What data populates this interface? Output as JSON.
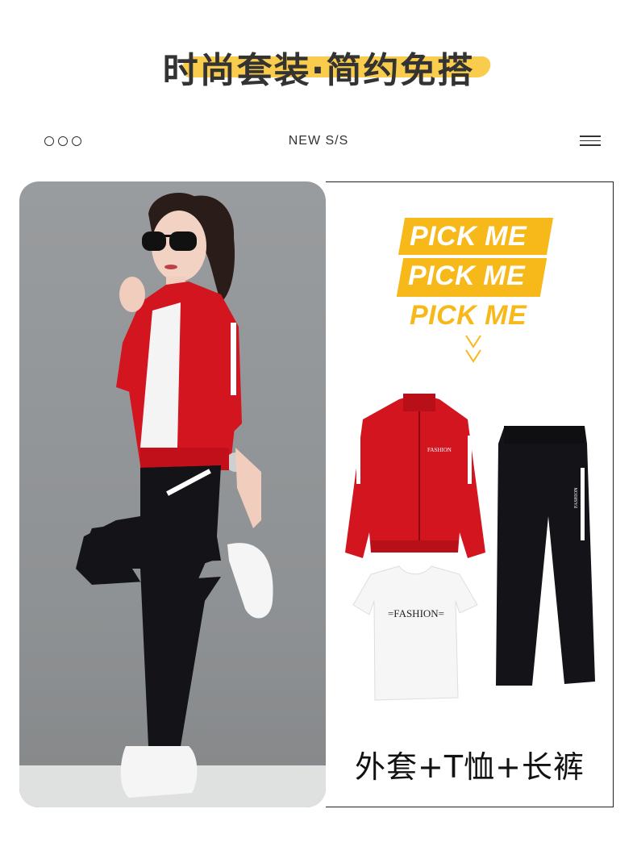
{
  "headline": "时尚套装·简约免搭",
  "topbar": {
    "left_icon": "three-circles-icon",
    "center_label": "NEW S/S",
    "right_icon": "hamburger-menu-icon"
  },
  "promo": {
    "lines": [
      "PICK ME",
      "PICK ME",
      "PICK ME"
    ],
    "chevron_icon": "double-chevron-down-icon"
  },
  "products": {
    "jacket_print": "FASHION",
    "tshirt_print": "=FASHION=",
    "pants_print": "FASHION",
    "caption": "外套+T恤+长裤"
  },
  "colors": {
    "accent_yellow": "#f7b81a",
    "jacket_red": "#d3151f",
    "pants_black": "#141418",
    "text_dark": "#333333"
  }
}
